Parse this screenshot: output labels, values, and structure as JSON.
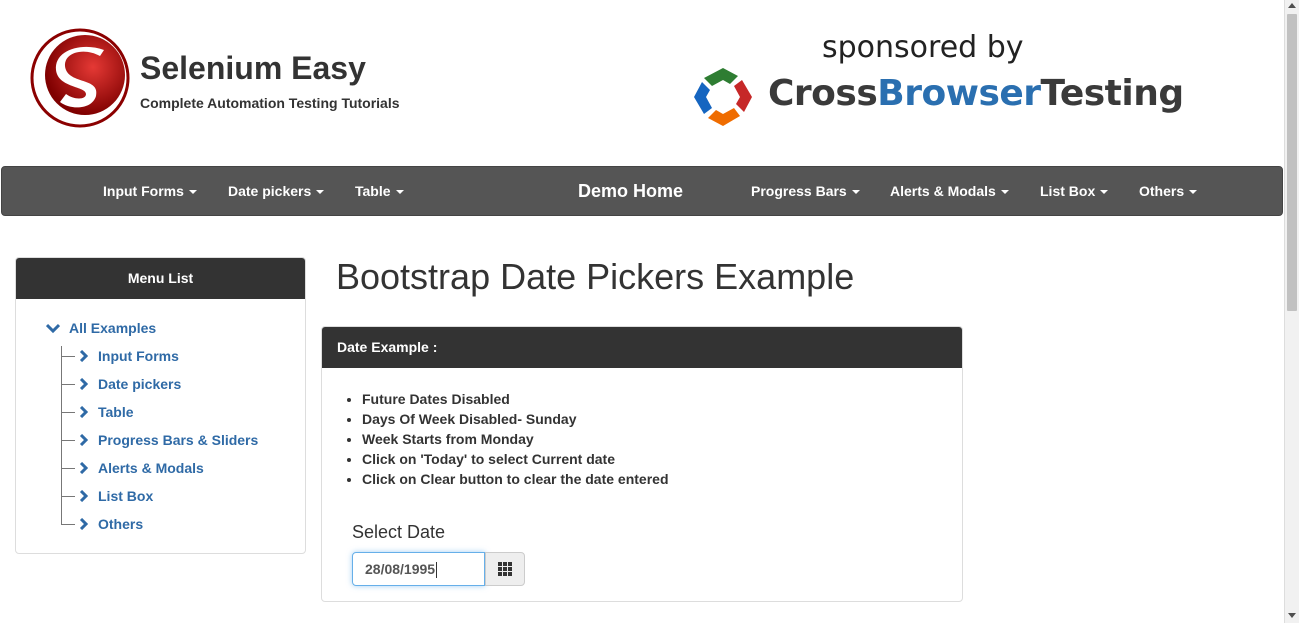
{
  "header": {
    "brand_title": "Selenium Easy",
    "brand_subtitle": "Complete Automation Testing Tutorials",
    "sponsored_text": "sponsored by",
    "sponsor_name_part1": "Cross",
    "sponsor_name_part2": "Browser",
    "sponsor_name_part3": "Testing"
  },
  "navbar": {
    "items": [
      {
        "label": "Input Forms"
      },
      {
        "label": "Date pickers"
      },
      {
        "label": "Table"
      },
      {
        "label": "Demo Home"
      },
      {
        "label": "Progress Bars"
      },
      {
        "label": "Alerts & Modals"
      },
      {
        "label": "List Box"
      },
      {
        "label": "Others"
      }
    ]
  },
  "sidebar": {
    "title": "Menu List",
    "root": "All Examples",
    "items": [
      {
        "label": "Input Forms"
      },
      {
        "label": "Date pickers"
      },
      {
        "label": "Table"
      },
      {
        "label": "Progress Bars & Sliders"
      },
      {
        "label": "Alerts & Modals"
      },
      {
        "label": "List Box"
      },
      {
        "label": "Others"
      }
    ]
  },
  "main": {
    "page_title": "Bootstrap Date Pickers Example",
    "panel_title": "Date Example :",
    "bullets": [
      "Future Dates Disabled",
      "Days Of Week Disabled- Sunday",
      "Week Starts from Monday",
      "Click on 'Today' to select Current date",
      "Click on Clear button to clear the date entered"
    ],
    "select_label": "Select Date",
    "date_value": "28/08/1995"
  },
  "colors": {
    "navbar_bg": "#555555",
    "panel_head_bg": "#333333",
    "link_blue": "#2f6aa6",
    "brand_red": "#c62828",
    "sponsor_blue": "#2a6fb0"
  }
}
